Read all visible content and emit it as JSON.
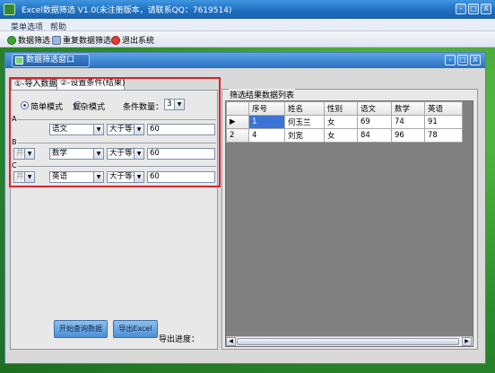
{
  "window": {
    "title": "Excel数据筛选 V1.0(未注册版本，请联系QQ：7619514)",
    "controls": [
      "-",
      "□",
      "X"
    ]
  },
  "menu": {
    "items": [
      "菜单选项",
      "帮助"
    ]
  },
  "toolbar": {
    "items": [
      "数据筛选",
      "重复数据筛选",
      "退出系统"
    ]
  },
  "inner_window": {
    "title": "数据筛选窗口",
    "controls": [
      "-",
      "□",
      "X"
    ]
  },
  "tabs": [
    "①-导入数据",
    "②-设置条件(结果)"
  ],
  "mode": {
    "simple": "简单模式",
    "complex": "复杂模式",
    "count_label": "条件数量：",
    "count_value": "3"
  },
  "conditions": [
    {
      "group": "A",
      "connector": "",
      "field": "语文",
      "operator": "大于等于",
      "value": "60"
    },
    {
      "group": "B",
      "connector": "并",
      "field": "数学",
      "operator": "大于等于",
      "value": "60"
    },
    {
      "group": "C",
      "connector": "并",
      "field": "英语",
      "operator": "大于等于",
      "value": "60"
    }
  ],
  "buttons": {
    "start_query": "开始查询数据",
    "export": "导出Excel"
  },
  "export_progress_label": "导出进度：",
  "result": {
    "title": "筛选结果数据列表",
    "columns": [
      "",
      "序号",
      "姓名",
      "性别",
      "语文",
      "数学",
      "英语"
    ],
    "rows": [
      {
        "rownum": "1",
        "cells": [
          "1",
          "何玉兰",
          "女",
          "69",
          "74",
          "91"
        ]
      },
      {
        "rownum": "2",
        "cells": [
          "4",
          "刘宽",
          "女",
          "84",
          "96",
          "78"
        ]
      }
    ]
  },
  "colors": {
    "highlight": "#d6232d",
    "selection": "#3b74d4",
    "title_blue": "#1f6fbf",
    "desktop_green": "#2d8a2c"
  }
}
